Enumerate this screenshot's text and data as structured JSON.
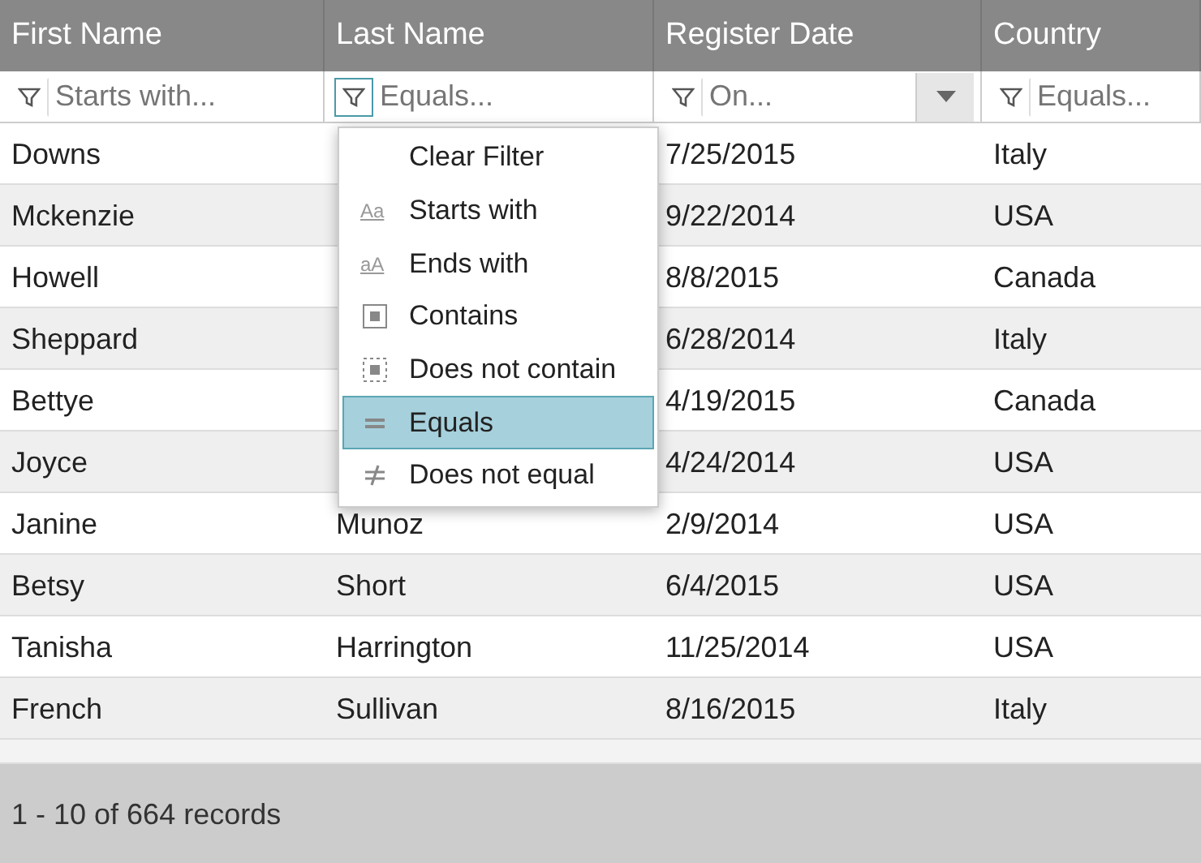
{
  "table": {
    "columns": [
      {
        "label": "First Name",
        "filter": {
          "placeholder": "Starts with...",
          "open": false,
          "dropdown": false
        }
      },
      {
        "label": "Last Name",
        "filter": {
          "placeholder": "Equals...",
          "open": true,
          "dropdown": false
        }
      },
      {
        "label": "Register Date",
        "filter": {
          "placeholder": "On...",
          "open": false,
          "dropdown": true
        }
      },
      {
        "label": "Country",
        "filter": {
          "placeholder": "Equals...",
          "open": false,
          "dropdown": false
        }
      }
    ],
    "rows": [
      [
        "Downs",
        null,
        "7/25/2015",
        "Italy"
      ],
      [
        "Mckenzie",
        null,
        "9/22/2014",
        "USA"
      ],
      [
        "Howell",
        null,
        "8/8/2015",
        "Canada"
      ],
      [
        "Sheppard",
        null,
        "6/28/2014",
        "Italy"
      ],
      [
        "Bettye",
        null,
        "4/19/2015",
        "Canada"
      ],
      [
        "Joyce",
        null,
        "4/24/2014",
        "USA"
      ],
      [
        "Janine",
        "Munoz",
        "2/9/2014",
        "USA"
      ],
      [
        "Betsy",
        "Short",
        "6/4/2015",
        "USA"
      ],
      [
        "Tanisha",
        "Harrington",
        "11/25/2014",
        "USA"
      ],
      [
        "French",
        "Sullivan",
        "8/16/2015",
        "Italy"
      ]
    ]
  },
  "filter_menu": {
    "items": [
      {
        "label": "Clear Filter",
        "kind": "clear",
        "selected": false
      },
      {
        "label": "Starts with",
        "kind": "starts",
        "icon_text": "Aa",
        "selected": false
      },
      {
        "label": "Ends with",
        "kind": "ends",
        "icon_text": "aA",
        "selected": false
      },
      {
        "label": "Contains",
        "kind": "contains",
        "selected": false
      },
      {
        "label": "Does not contain",
        "kind": "notcontains",
        "selected": false
      },
      {
        "label": "Equals",
        "kind": "equals",
        "selected": true
      },
      {
        "label": "Does not equal",
        "kind": "notequal",
        "selected": false
      }
    ]
  },
  "status_bar": {
    "text": "1 - 10 of 664 records"
  }
}
